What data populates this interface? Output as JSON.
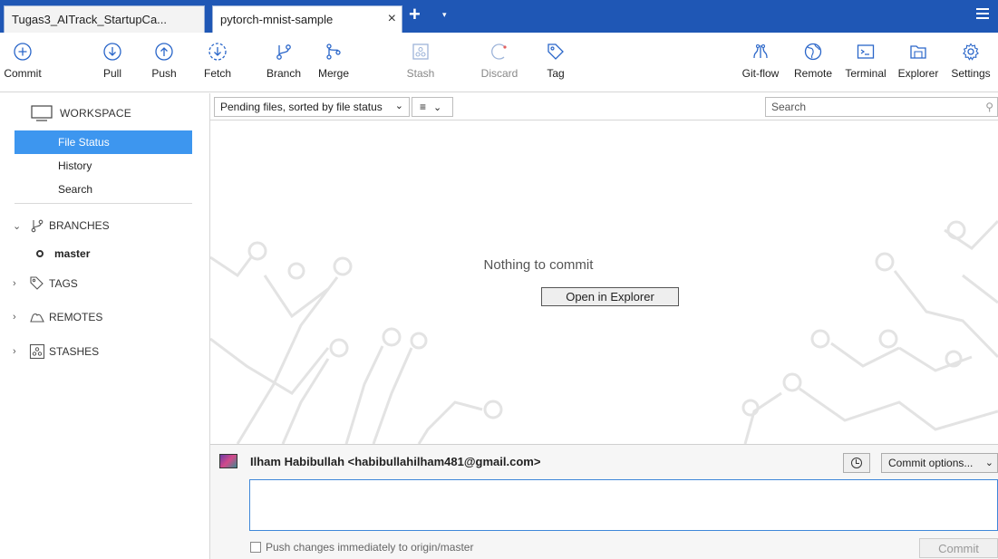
{
  "tabs": [
    {
      "label": "Tugas3_AITrack_StartupCa...",
      "active": false
    },
    {
      "label": "pytorch-mnist-sample",
      "active": true,
      "close_glyph": "×"
    }
  ],
  "tabbar": {
    "add_glyph": "+",
    "dropdown_glyph": "▾",
    "menu_icon": "hamburger-icon",
    "color": "#1f57b5"
  },
  "toolbar": {
    "commit": {
      "label": "Commit",
      "icon": "commit-icon"
    },
    "pull": {
      "label": "Pull",
      "icon": "pull-icon"
    },
    "push": {
      "label": "Push",
      "icon": "push-icon"
    },
    "fetch": {
      "label": "Fetch",
      "icon": "fetch-icon"
    },
    "branch": {
      "label": "Branch",
      "icon": "branch-icon"
    },
    "merge": {
      "label": "Merge",
      "icon": "merge-icon"
    },
    "stash": {
      "label": "Stash",
      "icon": "stash-icon",
      "enabled": false
    },
    "discard": {
      "label": "Discard",
      "icon": "discard-icon",
      "enabled": false
    },
    "tag": {
      "label": "Tag",
      "icon": "tag-icon"
    },
    "gitflow": {
      "label": "Git-flow",
      "icon": "gitflow-icon"
    },
    "remote": {
      "label": "Remote",
      "icon": "remote-icon"
    },
    "terminal": {
      "label": "Terminal",
      "icon": "terminal-icon"
    },
    "explorer": {
      "label": "Explorer",
      "icon": "explorer-icon"
    },
    "settings": {
      "label": "Settings",
      "icon": "gear-icon"
    }
  },
  "sidebar": {
    "workspace": {
      "label": "WORKSPACE",
      "icon": "monitor-icon"
    },
    "workspace_items": [
      "File Status",
      "History",
      "Search"
    ],
    "selected_item": "File Status",
    "branches": {
      "label": "BRANCHES",
      "expanded": true,
      "items": [
        "master"
      ],
      "current": "master"
    },
    "tags": {
      "label": "TAGS",
      "expanded": false
    },
    "remotes": {
      "label": "REMOTES",
      "expanded": false
    },
    "stashes": {
      "label": "STASHES",
      "expanded": false
    }
  },
  "filter": {
    "sort_label": "Pending files, sorted by file status",
    "view_mode_icon": "list-icon",
    "search_placeholder": "Search"
  },
  "pending": {
    "empty_message": "Nothing to commit",
    "open_explorer_label": "Open in Explorer"
  },
  "commit": {
    "author": "Ilham Habibullah <habibullahilham481@gmail.com>",
    "options_label": "Commit options...",
    "message": "",
    "push_label": "Push changes immediately to origin/master",
    "push_checked": false,
    "commit_label": "Commit"
  },
  "colors": {
    "accent": "#1f57b5",
    "selection": "#3d96ef",
    "icon_blue": "#2a66c9"
  }
}
